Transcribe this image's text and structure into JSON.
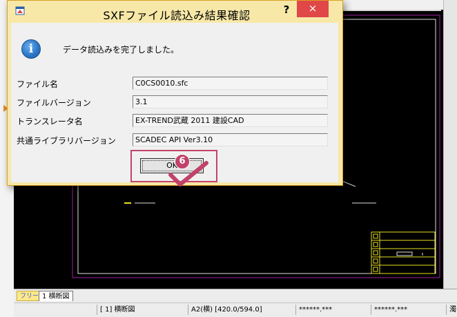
{
  "dialog": {
    "title": "SXFファイル読込み結果確認",
    "help_label": "?",
    "close_label": "×",
    "message": "データ読込みを完了しました。",
    "info_icon_glyph": "i",
    "fields": [
      {
        "label": "ファイル名",
        "value": "C0CS0010.sfc"
      },
      {
        "label": "ファイルバージョン",
        "value": "3.1"
      },
      {
        "label": "トランスレータ名",
        "value": "EX-TREND武蔵 2011 建設CAD"
      },
      {
        "label": "共通ライブラリバージョン",
        "value": "SCADEC API Ver3.10"
      }
    ],
    "ok_label": "OK",
    "step_number": "6"
  },
  "tabs": {
    "free": "フリー",
    "sheet": "1 横断図"
  },
  "status_bar": {
    "layer": "[ 1] 横断図",
    "paper": "A2(横) [420.0/594.0]",
    "coord_x": "******.***",
    "coord_y": "******.***",
    "extra": "濁"
  },
  "colors": {
    "dialog_frame": "#f8e8a8",
    "close_button": "#e04848",
    "annotation": "#c2426a",
    "cad_background": "#000000",
    "cad_frame": "#a020a0"
  },
  "icons": [
    "app-icon",
    "info-icon",
    "help-icon",
    "close-icon",
    "checkmark-icon"
  ]
}
